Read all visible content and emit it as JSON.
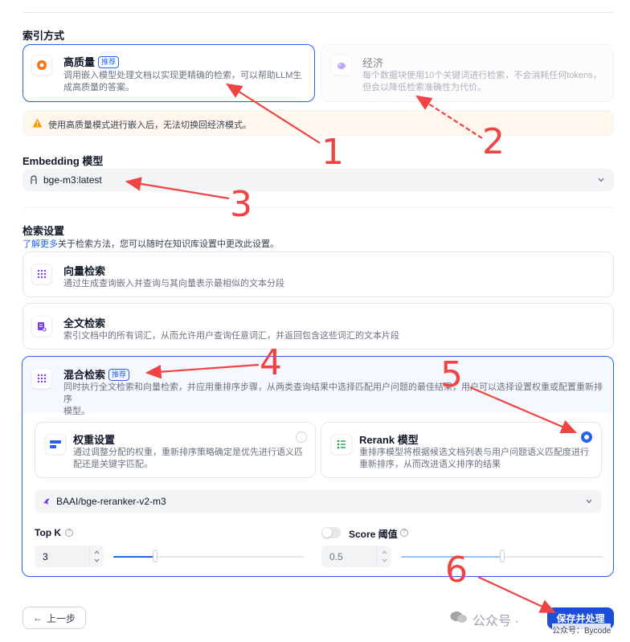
{
  "index_mode": {
    "title": "索引方式",
    "high_quality": {
      "label": "高质量",
      "badge": "推荐",
      "desc_line1": "调用嵌入模型处理文档以实现更精确的检索，可以帮助LLM生",
      "desc_line2": "成高质量的答案。"
    },
    "economy": {
      "label": "经济",
      "desc_line1": "每个数据块使用10个关键词进行检索，不会消耗任何tokens，",
      "desc_line2": "但会以降低检索准确性为代价。"
    },
    "warning": "使用高质量模式进行嵌入后，无法切换回经济模式。"
  },
  "embedding": {
    "title": "Embedding 模型",
    "model": "bge-m3:latest"
  },
  "retrieval": {
    "title": "检索设置",
    "learn_more": "了解更多",
    "subtitle": "关于检索方法，您可以随时在知识库设置中更改此设置。",
    "vector": {
      "label": "向量检索",
      "desc": "通过生成查询嵌入并查询与其向量表示最相似的文本分段"
    },
    "fulltext": {
      "label": "全文检索",
      "desc": "索引文档中的所有词汇，从而允许用户查询任意词汇，并返回包含这些词汇的文本片段"
    },
    "hybrid": {
      "label": "混合检索",
      "badge": "推荐",
      "desc_line1": "同时执行全文检索和向量检索，并应用重排序步骤，从两类查询结果中选择匹配用户问题的最佳结果，用户可以选择设置权重或配置重新排序",
      "desc_line2": "模型。",
      "weight": {
        "label": "权重设置",
        "desc_line1": "通过调整分配的权重，重新排序策略确定是优先进行语义匹",
        "desc_line2": "配还是关键字匹配。"
      },
      "rerank": {
        "label": "Rerank 模型",
        "desc_line1": "重排序模型将根据候选文档列表与用户问题语义匹配度进行",
        "desc_line2": "重新排序，从而改进语义排序的结果"
      },
      "rerank_model": "BAAI/bge-reranker-v2-m3",
      "top_k": {
        "label": "Top K",
        "value": "3",
        "slider_fraction": 0.22
      },
      "score": {
        "label": "Score 阈值",
        "value": "0.5",
        "slider_fraction": 0.5,
        "enabled": false
      }
    }
  },
  "footer": {
    "back": "上一步",
    "save": "保存并处理"
  },
  "watermark": {
    "text": "公众号 · ",
    "overlay": "公众号：Bycode"
  },
  "annotations": [
    "1",
    "2",
    "3",
    "4",
    "5",
    "6"
  ],
  "colors": {
    "accent": "#2563eb",
    "annotation": "#ef4444",
    "warning_icon": "#f59e0b"
  }
}
